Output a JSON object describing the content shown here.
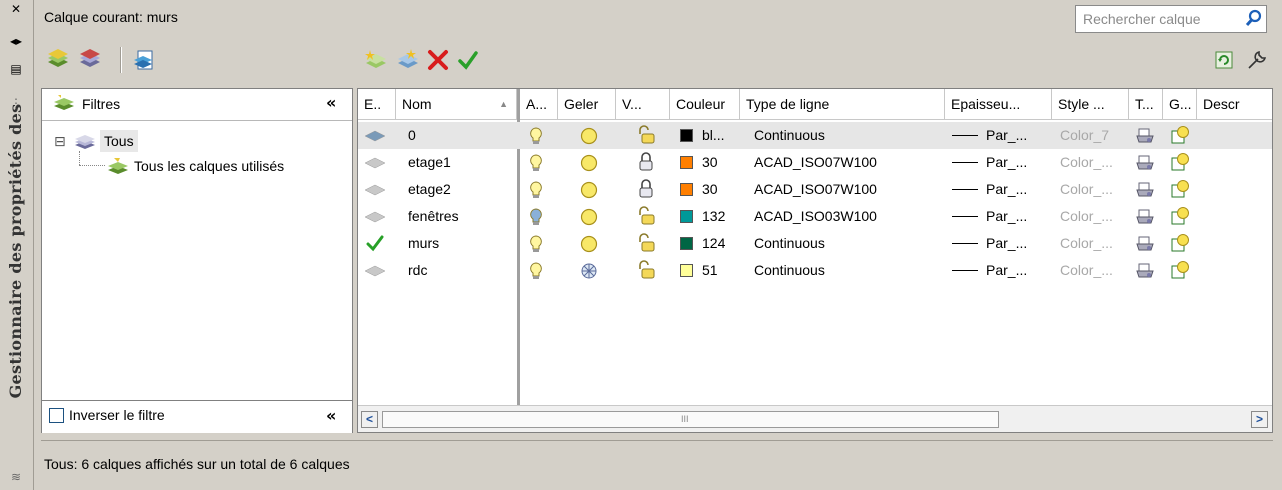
{
  "side_title": "Gestionnaire des propriétés des",
  "current_layer": "Calque courant: murs",
  "search": {
    "placeholder": "Rechercher calque"
  },
  "filters": {
    "header": "Filtres",
    "tree": [
      {
        "label": "Tous",
        "toggle": "⊟"
      },
      {
        "label": "Tous les calques utilisés"
      }
    ],
    "invert_label": "Inverser le filtre"
  },
  "collapse_glyph": "«",
  "columns": [
    "E..",
    "Nom",
    "A...",
    "Geler",
    "V...",
    "Couleur",
    "Type de ligne",
    "Epaisseu...",
    "Style ...",
    "T...",
    "G...",
    "Descr"
  ],
  "layers": [
    {
      "status": "current_hint",
      "name": "0",
      "on": true,
      "frozen": false,
      "locked": false,
      "color_hex": "#000000",
      "color": "bl...",
      "linetype": "Continuous",
      "lineweight": "Par_...",
      "style": "Color_7"
    },
    {
      "status": "",
      "name": "etage1",
      "on": true,
      "frozen": false,
      "locked": true,
      "color_hex": "#ff7f00",
      "color": "30",
      "linetype": "ACAD_ISO07W100",
      "lineweight": "Par_...",
      "style": "Color_..."
    },
    {
      "status": "",
      "name": "etage2",
      "on": true,
      "frozen": false,
      "locked": true,
      "color_hex": "#ff7f00",
      "color": "30",
      "linetype": "ACAD_ISO07W100",
      "lineweight": "Par_...",
      "style": "Color_..."
    },
    {
      "status": "",
      "name": "fenêtres",
      "on": false,
      "frozen": false,
      "locked": false,
      "color_hex": "#009999",
      "color": "132",
      "linetype": "ACAD_ISO03W100",
      "lineweight": "Par_...",
      "style": "Color_..."
    },
    {
      "status": "current",
      "name": "murs",
      "on": true,
      "frozen": false,
      "locked": false,
      "color_hex": "#006644",
      "color": "124",
      "linetype": "Continuous",
      "lineweight": "Par_...",
      "style": "Color_..."
    },
    {
      "status": "",
      "name": "rdc",
      "on": true,
      "frozen": true,
      "locked": false,
      "color_hex": "#ffff99",
      "color": "51",
      "linetype": "Continuous",
      "lineweight": "Par_...",
      "style": "Color_..."
    }
  ],
  "scroll": {
    "left": "<",
    "right": ">",
    "grip": "III"
  },
  "status_text": "Tous: 6 calques affichés sur un total de 6 calques"
}
